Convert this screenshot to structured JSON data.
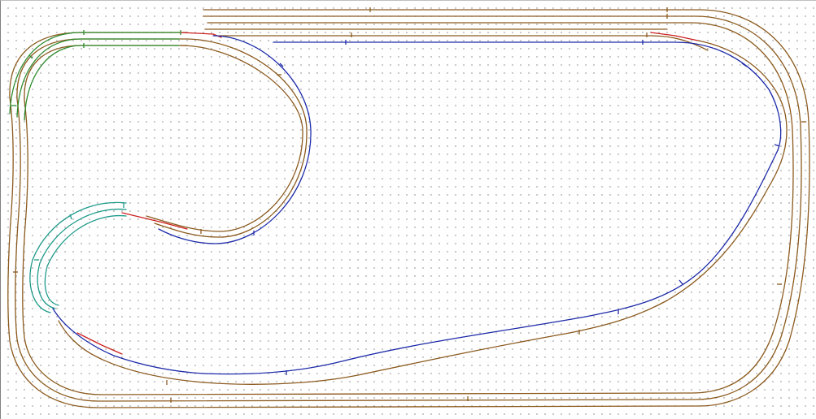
{
  "canvas": {
    "grid": true,
    "background": "#ffffff",
    "grid_dot_color": "#9a9a9a"
  },
  "colors": {
    "brown": "#8b5a1e",
    "blue": "#1c2aa8",
    "green": "#2e8b2e",
    "teal": "#1e9a8a",
    "red": "#cc1f1f"
  },
  "tracks": [
    {
      "id": "outer-loop-1",
      "color": "brown"
    },
    {
      "id": "outer-loop-2",
      "color": "brown"
    },
    {
      "id": "outer-loop-3",
      "color": "brown"
    },
    {
      "id": "top-siding-1",
      "color": "brown"
    },
    {
      "id": "top-siding-2",
      "color": "brown"
    },
    {
      "id": "blue-siding",
      "color": "blue"
    },
    {
      "id": "inner-blue-loop",
      "color": "blue"
    },
    {
      "id": "upper-left-green-curve",
      "color": "green"
    },
    {
      "id": "inner-teal-curve",
      "color": "teal"
    },
    {
      "id": "switch-segments",
      "color": "red"
    }
  ]
}
